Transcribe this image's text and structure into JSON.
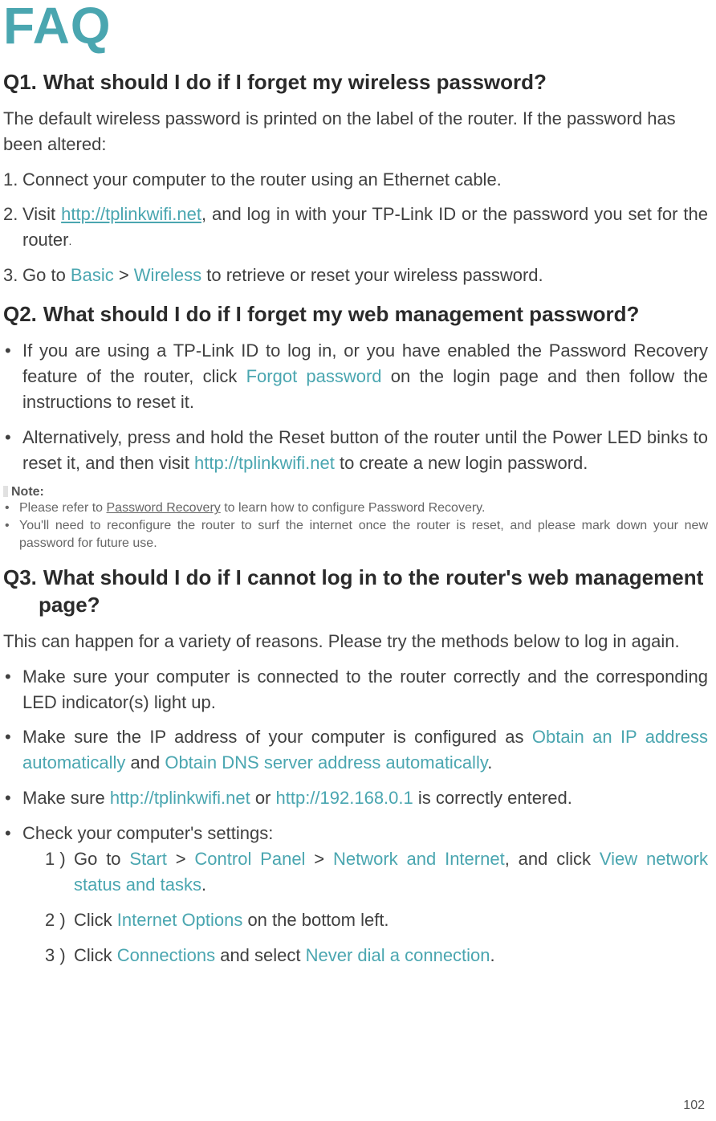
{
  "title": "FAQ",
  "q1": {
    "num": "Q1.",
    "heading": "What should I do if I forget my wireless password?",
    "intro": "The default wireless password is printed on the label of the router. If the password has been altered:",
    "steps": {
      "s1": "Connect your computer to the router using an Ethernet cable.",
      "s2a": "Visit ",
      "s2link": "http://tplinkwifi.net",
      "s2b": ", and log in with your TP-Link ID or the password you set for the router",
      "s3a": "Go to ",
      "s3basic": "Basic",
      "s3sep": " > ",
      "s3wireless": "Wireless",
      "s3b": " to retrieve or reset your wireless password."
    }
  },
  "q2": {
    "num": "Q2.",
    "heading": "What should I do if I forget my web management password?",
    "b1a": "If you are using a TP-Link ID to log in, or you have enabled the Password Recovery feature of the router, click ",
    "b1forgot": "Forgot password",
    "b1b": " on the login page and then follow the instructions to reset it.",
    "b2a": "Alternatively, press and hold the Reset button of the router until the Power LED binks to reset it, and then visit ",
    "b2link": "http://tplinkwifi.net",
    "b2b": " to create a new login password.",
    "note_label": "Note:",
    "note1a": "Please refer to ",
    "note1link": "Password Recovery",
    "note1b": " to learn how to configure Password Recovery.",
    "note2": "You'll need to reconfigure the router to surf the internet once the router is reset, and please mark down your new password for future use."
  },
  "q3": {
    "num": "Q3.",
    "heading_l1": "What should I do if I cannot log in to the router's web management",
    "heading_l2": "page?",
    "intro": "This can happen for a variety of reasons. Please try the methods below to log in again.",
    "b1": "Make sure your computer is connected to the router correctly and the corresponding LED indicator(s) light up.",
    "b2a": "Make sure the IP address of your computer is configured as ",
    "b2ip": "Obtain an IP address automatically",
    "b2and": " and ",
    "b2dns": "Obtain DNS server address automatically",
    "b3a": "Make sure ",
    "b3link1": "http://tplinkwifi.net",
    "b3or": " or ",
    "b3link2": "http://192.168.0.1",
    "b3b": " is correctly entered.",
    "b4": "Check your computer's settings:",
    "sub1a": "Go to ",
    "sub1start": "Start",
    "sep": " > ",
    "sub1cp": "Control Panel",
    "sub1ni": "Network and Internet",
    "sub1b": ", and click ",
    "sub1view": "View network status and tasks",
    "sub2a": "Click ",
    "sub2io": "Internet Options",
    "sub2b": " on the bottom left.",
    "sub3a": "Click ",
    "sub3conn": "Connections",
    "sub3b": " and select ",
    "sub3never": "Never dial a connection"
  },
  "dot": ".",
  "page_number": "102"
}
